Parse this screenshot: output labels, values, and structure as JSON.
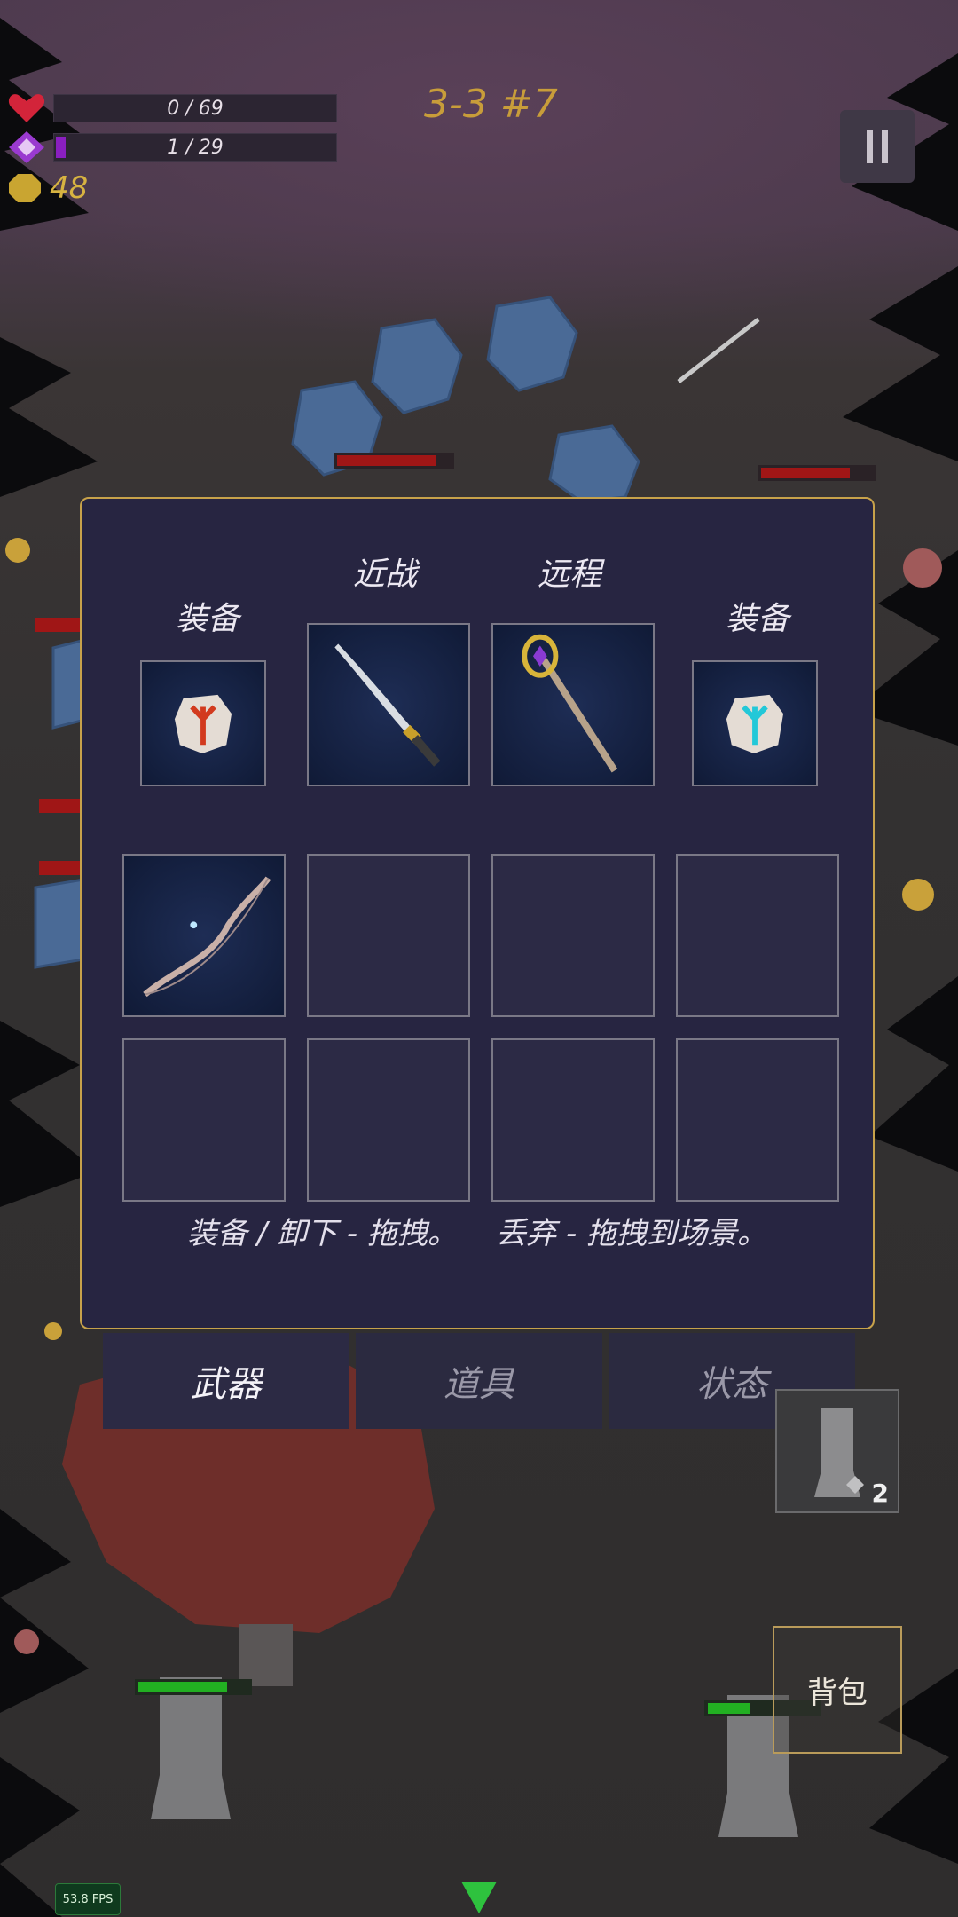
{
  "hud": {
    "health": {
      "text": "0 / 69",
      "fraction": 0.0,
      "icon": "heart-icon",
      "color": "#d3243a"
    },
    "mana": {
      "text": "1 / 29",
      "fraction": 0.034,
      "icon": "diamond-icon",
      "color": "#8a1fc0"
    },
    "gold": {
      "value": "48",
      "icon": "coin-icon",
      "color": "#d7b341"
    },
    "level": "3-3 #7",
    "pause": "pause-icon"
  },
  "inventory": {
    "headers": {
      "equip_left": "装备",
      "melee": "近战",
      "ranged": "远程",
      "equip_right": "装备"
    },
    "equipped": {
      "left_rune": "rune-red-icon",
      "melee_weapon": "katana-icon",
      "ranged_weapon": "staff-icon",
      "right_rune": "rune-cyan-icon"
    },
    "grid": [
      {
        "item": "bow-icon"
      },
      {
        "item": ""
      },
      {
        "item": ""
      },
      {
        "item": ""
      },
      {
        "item": ""
      },
      {
        "item": ""
      },
      {
        "item": ""
      },
      {
        "item": ""
      }
    ],
    "hint": "装备 / 卸下 - 拖拽。    丢弃 - 拖拽到场景。"
  },
  "tabs": [
    {
      "label": "武器",
      "active": true
    },
    {
      "label": "道具",
      "active": false
    },
    {
      "label": "状态",
      "active": false
    }
  ],
  "quick_item": {
    "count": "2",
    "icon": "moai-icon"
  },
  "backpack_button": "背包",
  "fps": "53.8 FPS",
  "colors": {
    "panel_border": "#c7a24a",
    "panel_bg": "#272541",
    "enemy_hp": "#a01616",
    "ally_hp": "#22b022"
  }
}
